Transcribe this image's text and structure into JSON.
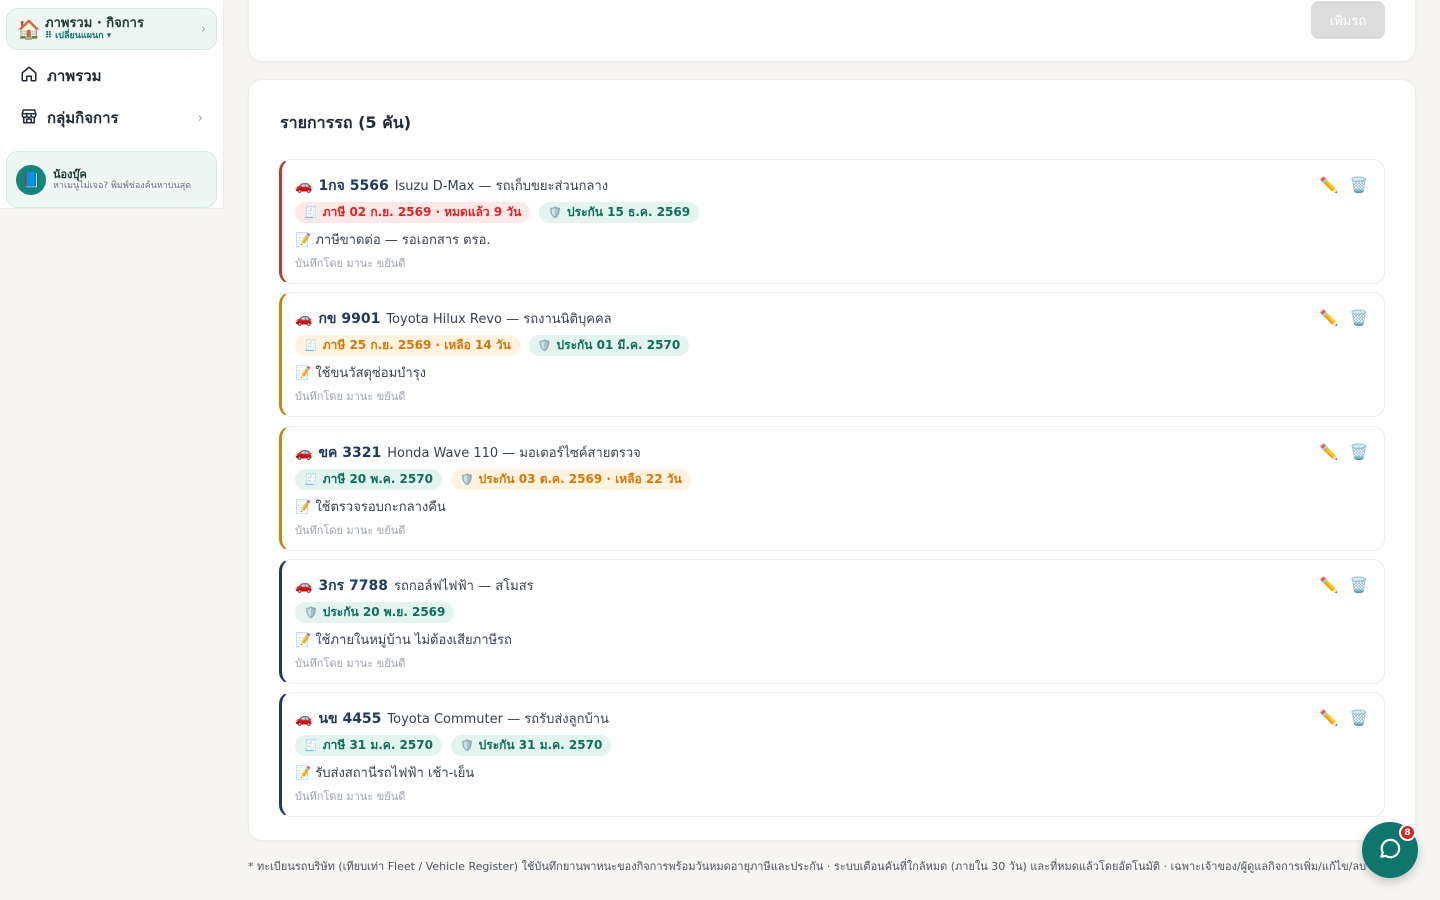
{
  "sidebar": {
    "workspace": {
      "title": "ภาพรวม · กิจการ",
      "subtitle": "⠿ เปลี่ยนแผนก ▾"
    },
    "nav": [
      {
        "label": "ภาพรวม"
      },
      {
        "label": "กลุ่มกิจการ"
      }
    ],
    "help": {
      "name": "น้องบุ๊ค",
      "subtitle": "หาเมนูไม่เจอ? พิมพ์ช่องค้นหาบนสุด"
    }
  },
  "toolbar": {
    "add_label": "เพิ่มรถ"
  },
  "list": {
    "title": "รายการรถ (5 คัน)",
    "vehicles": [
      {
        "plate": "1กจ 5566",
        "model": "Isuzu D-Max — รถเก็บขยะส่วนกลาง",
        "badges": [
          {
            "text": "ภาษี 02 ก.ย. 2569 · หมดแล้ว 9 วัน",
            "tone": "red",
            "icon": "receipt-icon"
          },
          {
            "text": "ประกัน 15 ธ.ค. 2569",
            "tone": "teal",
            "icon": "shield-icon"
          }
        ],
        "note": "📝 ภาษีขาดต่อ — รอเอกสาร ตรอ.",
        "recorded_by": "บันทึกโดย มานะ ขยันดี",
        "accent": "#c0392b"
      },
      {
        "plate": "กข 9901",
        "model": "Toyota Hilux Revo — รถงานนิติบุคคล",
        "badges": [
          {
            "text": "ภาษี 25 ก.ย. 2569 · เหลือ 14 วัน",
            "tone": "amber",
            "icon": "receipt-icon"
          },
          {
            "text": "ประกัน 01 มี.ค. 2570",
            "tone": "teal",
            "icon": "shield-icon"
          }
        ],
        "note": "📝 ใช้ขนวัสดุซ่อมบำรุง",
        "recorded_by": "บันทึกโดย มานะ ขยันดี",
        "accent": "#c8860a"
      },
      {
        "plate": "ขค 3321",
        "model": "Honda Wave 110 — มอเตอร์ไซค์สายตรวจ",
        "badges": [
          {
            "text": "ภาษี 20 พ.ค. 2570",
            "tone": "teal",
            "icon": "receipt-icon"
          },
          {
            "text": "ประกัน 03 ต.ค. 2569 · เหลือ 22 วัน",
            "tone": "amber",
            "icon": "shield-icon"
          }
        ],
        "note": "📝 ใช้ตรวจรอบกะกลางคืน",
        "recorded_by": "บันทึกโดย มานะ ขยันดี",
        "accent": "#c8860a"
      },
      {
        "plate": "3กร 7788",
        "model": "รถกอล์ฟไฟฟ้า — สโมสร",
        "badges": [
          {
            "text": "ประกัน 20 พ.ย. 2569",
            "tone": "teal",
            "icon": "shield-icon"
          }
        ],
        "note": "📝 ใช้ภายในหมู่บ้าน ไม่ต้องเสียภาษีรถ",
        "recorded_by": "บันทึกโดย มานะ ขยันดี",
        "accent": "#1e3a5f"
      },
      {
        "plate": "นข 4455",
        "model": "Toyota Commuter — รถรับส่งลูกบ้าน",
        "badges": [
          {
            "text": "ภาษี 31 ม.ค. 2570",
            "tone": "teal",
            "icon": "receipt-icon"
          },
          {
            "text": "ประกัน 31 ม.ค. 2570",
            "tone": "teal",
            "icon": "shield-icon"
          }
        ],
        "note": "📝 รับส่งสถานีรถไฟฟ้า เช้า-เย็น",
        "recorded_by": "บันทึกโดย มานะ ขยันดี",
        "accent": "#1e3a5f"
      }
    ]
  },
  "footnote": "* ทะเบียนรถบริษัท (เทียบเท่า Fleet / Vehicle Register) ใช้บันทึกยานพาหนะของกิจการพร้อมวันหมดอายุภาษีและประกัน · ระบบเตือนคันที่ใกล้หมด (ภายใน 30 วัน) และที่หมดแล้วโดยอัตโนมัติ · เฉพาะเจ้าของ/ผู้ดูแลกิจการเพิ่ม/แก้ไข/ลบได้",
  "chat": {
    "badge_count": "8"
  },
  "colors": {
    "primary": "#0f766e",
    "danger": "#dc2626",
    "warning": "#d97706",
    "navy": "#1e3a5f"
  }
}
